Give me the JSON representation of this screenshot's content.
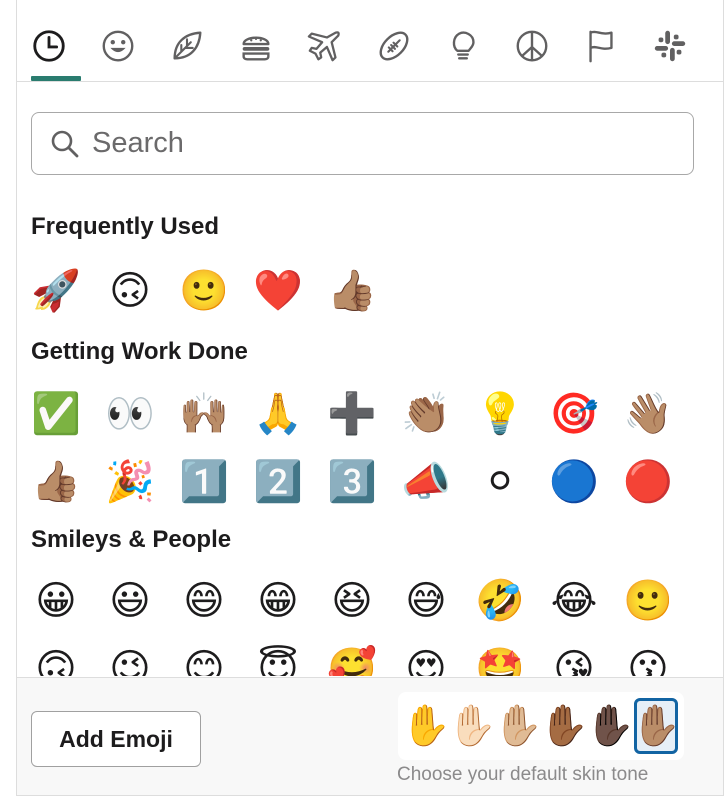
{
  "categories": [
    {
      "name": "recent",
      "icon": "clock-icon"
    },
    {
      "name": "smileys",
      "icon": "smiley-icon"
    },
    {
      "name": "nature",
      "icon": "leaf-icon"
    },
    {
      "name": "food",
      "icon": "burger-icon"
    },
    {
      "name": "travel",
      "icon": "airplane-icon"
    },
    {
      "name": "activities",
      "icon": "football-icon"
    },
    {
      "name": "objects",
      "icon": "lightbulb-icon"
    },
    {
      "name": "symbols",
      "icon": "peace-icon"
    },
    {
      "name": "flags",
      "icon": "flag-icon"
    },
    {
      "name": "custom",
      "icon": "slack-logo-icon"
    }
  ],
  "search": {
    "placeholder": "Search"
  },
  "sections": {
    "frequent": {
      "title": "Frequently Used",
      "emoji": [
        "🚀",
        "🙃",
        "🙂",
        "❤️",
        "👍🏽"
      ]
    },
    "work": {
      "title": "Getting Work Done",
      "row1": [
        "✅",
        "👀",
        "🙌🏽",
        "🙏",
        "➕",
        "👏🏽",
        "💡",
        "🎯",
        "👋🏽"
      ],
      "row2": [
        "👍🏽",
        "🎉",
        "1️⃣",
        "2️⃣",
        "3️⃣",
        "📣",
        "⚪",
        "🔵",
        "🔴"
      ]
    },
    "smileys": {
      "title": "Smileys & People",
      "row1": [
        "😀",
        "😃",
        "😄",
        "😁",
        "😆",
        "😅",
        "🤣",
        "😂",
        "🙂"
      ],
      "row2": [
        "🙃",
        "😉",
        "😊",
        "😇",
        "🥰",
        "😍",
        "🤩",
        "😘",
        "😗"
      ]
    }
  },
  "footer": {
    "add_emoji_label": "Add Emoji",
    "skin_tones": [
      "✋",
      "✋🏻",
      "✋🏼",
      "✋🏾",
      "✋🏿",
      "✋🏽"
    ],
    "selected_tone_index": 5,
    "skin_tone_hint": "Choose your default skin tone"
  },
  "colors": {
    "accent": "#2a7c6f",
    "selected_border": "#1264a3"
  }
}
